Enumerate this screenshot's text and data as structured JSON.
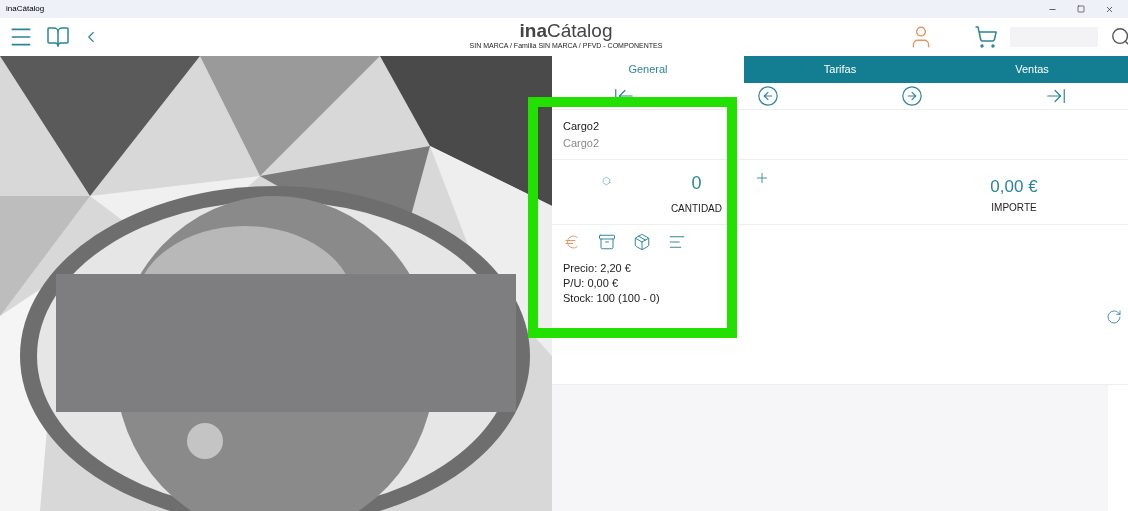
{
  "window": {
    "title": "inaCátalog"
  },
  "header": {
    "logo": "**ina**Cátalog",
    "breadcrumb": "SIN MARCA / Familia SIN MARCA / PFVD - COMPONENTES"
  },
  "tabs": [
    {
      "label": "General",
      "selected": true
    },
    {
      "label": "Tarifas",
      "selected": false
    },
    {
      "label": "Ventas",
      "selected": false
    }
  ],
  "item": {
    "name": "Cargo2",
    "subtitle": "Cargo2"
  },
  "quantity": {
    "value": "0",
    "label": "CANTIDAD"
  },
  "amount": {
    "value": "0,00 €",
    "label": "IMPORTE"
  },
  "details": [
    "Precio: 2,20 €",
    "P/U: 0,00 €",
    "Stock: 100 (100 - 0)"
  ]
}
